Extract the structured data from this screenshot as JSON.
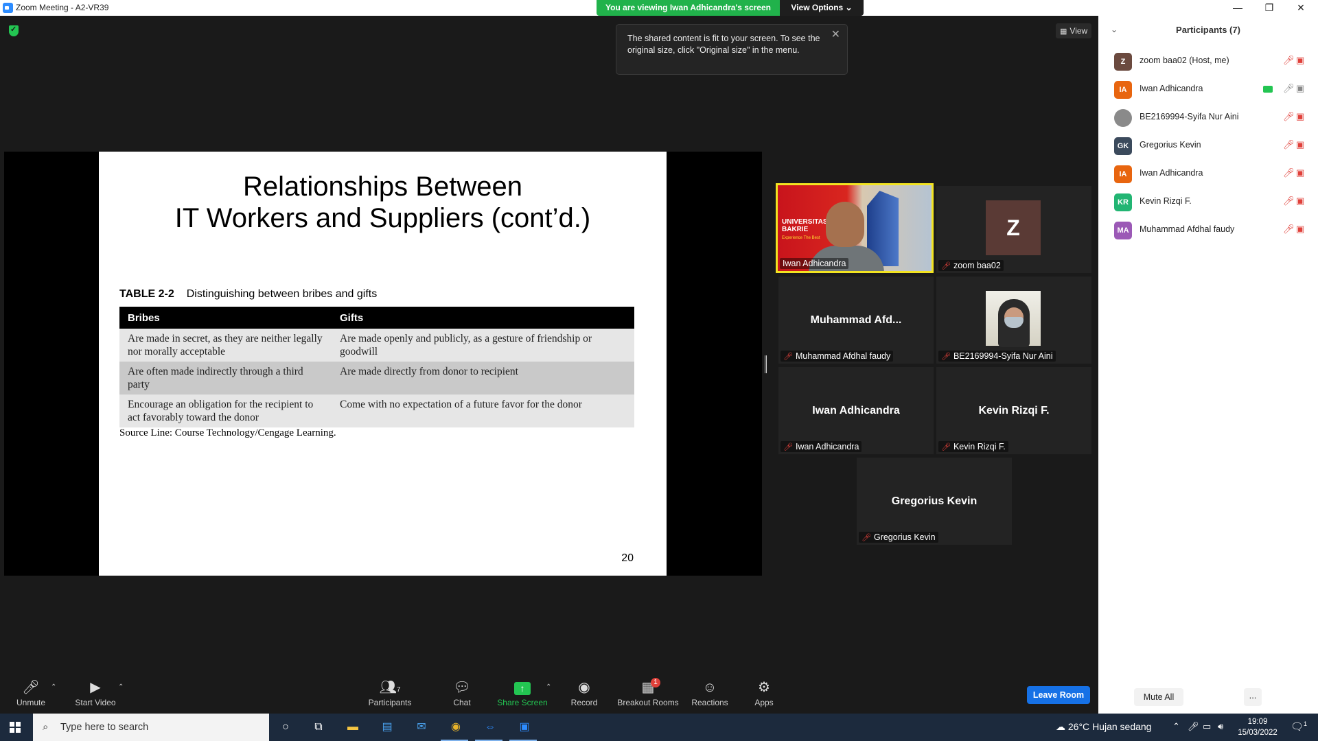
{
  "window": {
    "title": "Zoom Meeting - A2-VR39",
    "viewing_banner": "You are viewing Iwan Adhicandra's screen",
    "view_options": "View Options ⌄",
    "controls": {
      "minimize": "—",
      "restore": "❐",
      "close": "✕"
    }
  },
  "meeting": {
    "view_button": "View",
    "tooltip_text": "The shared content is fit to your screen. To see the original size, click \"Original size\" in the menu.",
    "tooltip_close": "✕"
  },
  "slide": {
    "title_line1": "Relationships Between",
    "title_line2": "IT Workers and Suppliers (cont’d.)",
    "table_label": "TABLE 2-2",
    "table_caption": "Distinguishing between bribes and gifts",
    "columns": [
      "Bribes",
      "Gifts"
    ],
    "rows": [
      [
        "Are made in secret, as they are neither legally nor morally acceptable",
        "Are made openly and publicly, as a gesture of friendship or goodwill"
      ],
      [
        "Are often made indirectly through a third party",
        "Are made directly from donor to recipient"
      ],
      [
        "Encourage an obligation for the recipient to act favorably toward the donor",
        "Come with no expectation of a future favor for the donor"
      ]
    ],
    "source": "Source Line: Course Technology/Cengage Learning.",
    "page_number": "20"
  },
  "tiles": [
    {
      "name": "Iwan Adhicandra",
      "big": "",
      "kind": "video",
      "uni_line1": "UNIVERSITAS",
      "uni_line2": "BAKRIE",
      "uni_tag": "Experience The Best"
    },
    {
      "name": "zoom baa02",
      "big": "Z",
      "kind": "avatar"
    },
    {
      "name": "Muhammad Afdhal faudy",
      "big": "Muhammad  Afd...",
      "kind": "name"
    },
    {
      "name": "BE2169994-Syifa Nur Aini",
      "big": "",
      "kind": "photo"
    },
    {
      "name": "Iwan Adhicandra",
      "big": "Iwan Adhicandra",
      "kind": "name"
    },
    {
      "name": "Kevin Rizqi F.",
      "big": "Kevin Rizqi F.",
      "kind": "name"
    },
    {
      "name": "Gregorius Kevin",
      "big": "Gregorius Kevin",
      "kind": "name"
    }
  ],
  "toolbar": {
    "unmute": "Unmute",
    "start_video": "Start Video",
    "participants": "Participants",
    "participants_count": "7",
    "chat": "Chat",
    "share_screen": "Share Screen",
    "record": "Record",
    "breakout_rooms": "Breakout Rooms",
    "breakout_badge": "1",
    "reactions": "Reactions",
    "apps": "Apps",
    "leave_room": "Leave Room"
  },
  "panel": {
    "title": "Participants (7)",
    "participants": [
      {
        "initials": "Z",
        "name": "zoom baa02 (Host, me)",
        "color": "#6b4a3f",
        "mic": "muted",
        "cam": "off"
      },
      {
        "initials": "IA",
        "name": "Iwan Adhicandra",
        "color": "#e8650f",
        "mic": "on",
        "cam": "on",
        "sharing": true
      },
      {
        "initials": "",
        "name": "BE2169994-Syifa Nur Aini",
        "color": "#8a8a8a",
        "mic": "muted",
        "cam": "off"
      },
      {
        "initials": "GK",
        "name": "Gregorius Kevin",
        "color": "#3b4a5c",
        "mic": "muted",
        "cam": "off"
      },
      {
        "initials": "IA",
        "name": "Iwan Adhicandra",
        "color": "#e8650f",
        "mic": "muted",
        "cam": "off"
      },
      {
        "initials": "KR",
        "name": "Kevin Rizqi F.",
        "color": "#22b573",
        "mic": "muted",
        "cam": "off"
      },
      {
        "initials": "MA",
        "name": "Muhammad Afdhal faudy",
        "color": "#9b59b6",
        "mic": "muted",
        "cam": "off"
      }
    ],
    "mute_all": "Mute All",
    "more": "..."
  },
  "taskbar": {
    "search_placeholder": "Type here to search",
    "temperature": "26°C",
    "weather": "Hujan sedang",
    "time": "19:09",
    "date": "15/03/2022",
    "notification_count": "1"
  }
}
